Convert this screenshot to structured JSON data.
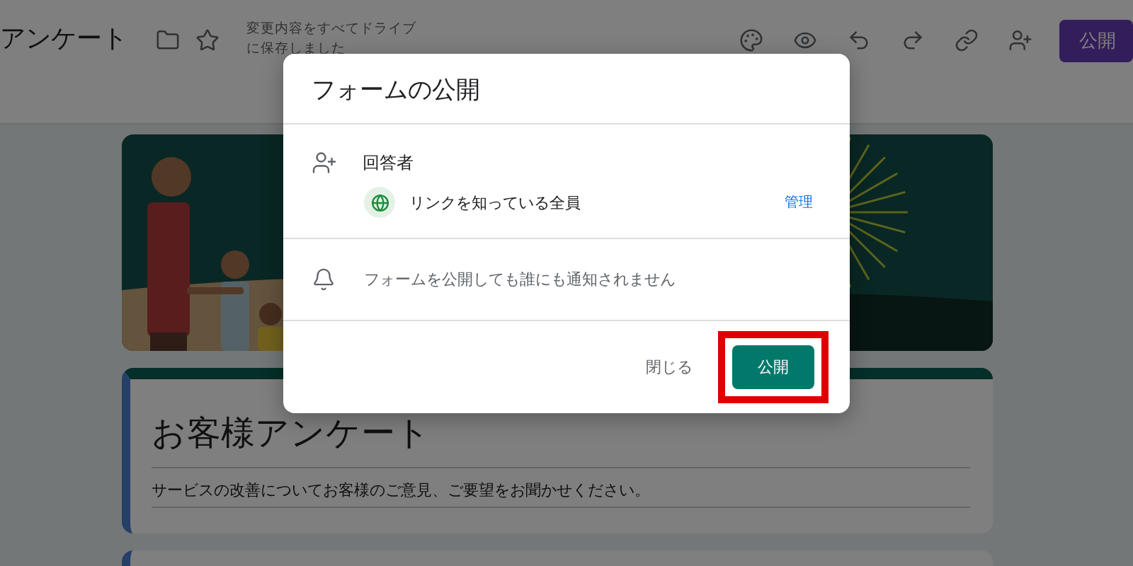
{
  "header": {
    "title": "アンケート",
    "save_status": "変更内容をすべてドライブに保存しました",
    "publish_button": {
      "label": "公開"
    }
  },
  "form": {
    "title": "お客様アンケート",
    "description": "サービスの改善についてお客様のご意見、ご要望をお聞かせください。"
  },
  "dialog": {
    "title": "フォームの公開",
    "responders": {
      "label": "回答者",
      "audience": "リンクを知っている全員",
      "manage_link": "管理"
    },
    "notice": "フォームを公開しても誰にも通知されません",
    "buttons": [
      {
        "kind": "text",
        "label": "閉じる",
        "highlighted": false
      },
      {
        "kind": "filled",
        "label": "公開",
        "highlighted": true
      }
    ]
  }
}
